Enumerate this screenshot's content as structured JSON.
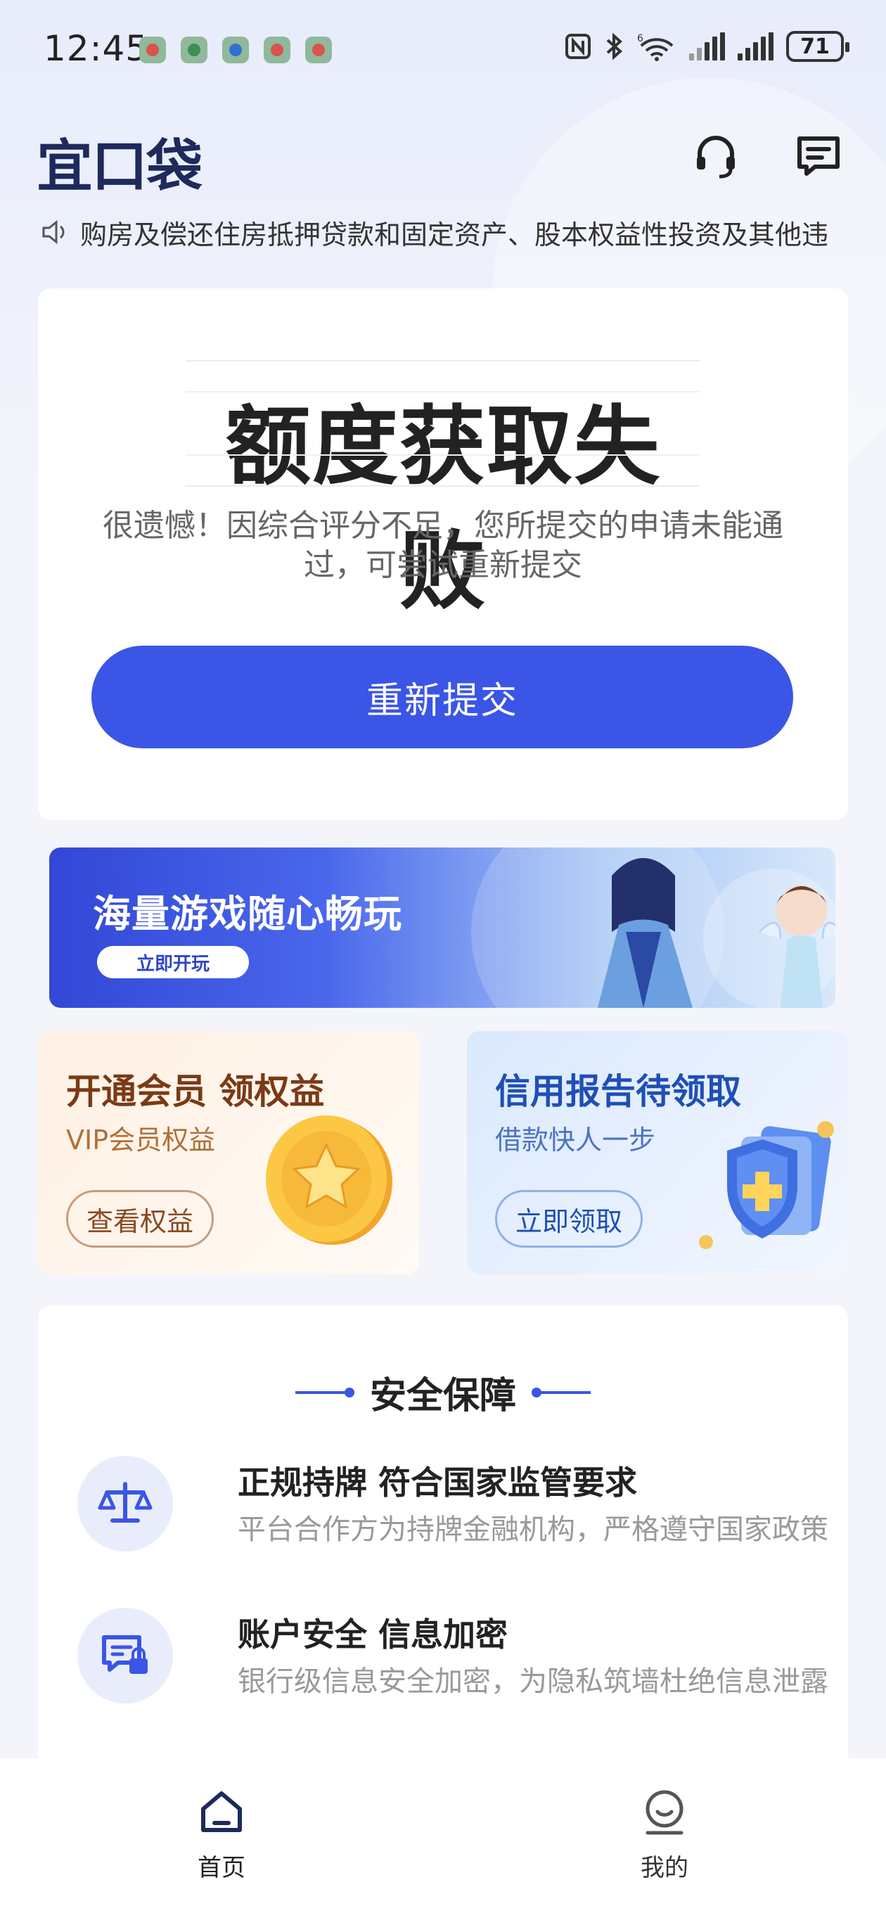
{
  "status_bar": {
    "time": "12:45",
    "network_label": "6",
    "battery": "71"
  },
  "header": {
    "logo": "宜口袋",
    "support_icon": "headset-icon",
    "message_icon": "message-icon"
  },
  "notice": {
    "icon": "speaker-icon",
    "text": "购房及偿还住房抵押贷款和固定资产、股本权益性投资及其他违"
  },
  "result": {
    "title": "额度获取失败",
    "description": "很遗憾！因综合评分不足，您所提交的申请未能通过，可尝试重新提交",
    "button": "重新提交"
  },
  "game_banner": {
    "title": "海量游戏随心畅玩",
    "button": "立即开玩"
  },
  "promos": [
    {
      "title": "开通会员 领权益",
      "subtitle": "VIP会员权益",
      "button": "查看权益"
    },
    {
      "title": "信用报告待领取",
      "subtitle": "借款快人一步",
      "button": "立即领取"
    }
  ],
  "security": {
    "title": "安全保障",
    "items": [
      {
        "icon": "scale-icon",
        "title": "正规持牌 符合国家监管要求",
        "desc": "平台合作方为持牌金融机构，严格遵守国家政策"
      },
      {
        "icon": "secure-chat-icon",
        "title": "账户安全 信息加密",
        "desc": "银行级信息安全加密，为隐私筑墙杜绝信息泄露"
      }
    ]
  },
  "bottom_nav": {
    "home": "首页",
    "mine": "我的"
  },
  "colors": {
    "primary": "#3b55e6",
    "logo": "#1e2a5c"
  }
}
